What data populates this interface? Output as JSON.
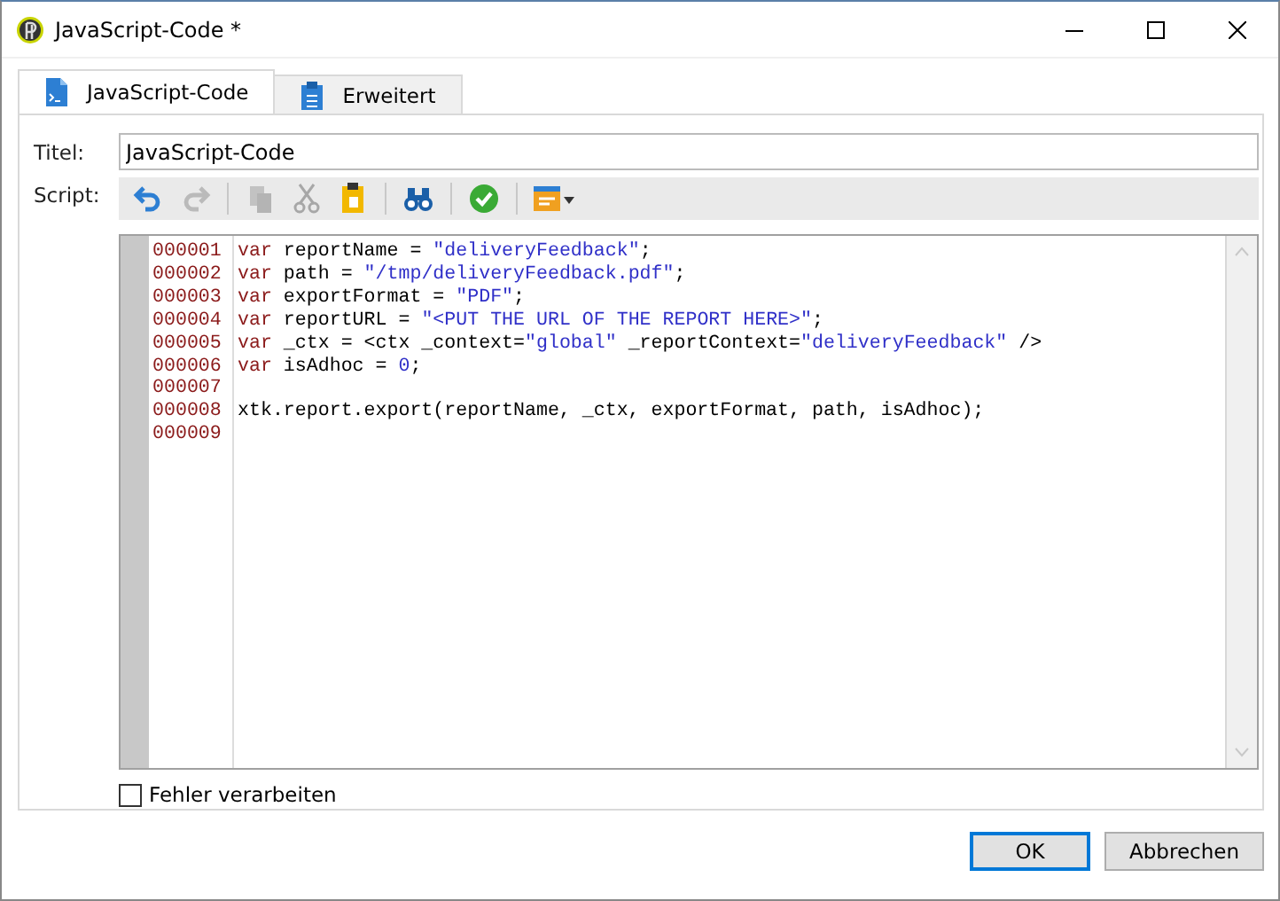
{
  "window": {
    "title": "JavaScript-Code *"
  },
  "tabs": [
    {
      "label": "JavaScript-Code",
      "selected": true,
      "kind": "script"
    },
    {
      "label": "Erweitert",
      "selected": false,
      "kind": "clipboard"
    }
  ],
  "title_field": {
    "label": "Titel:",
    "value": "JavaScript-Code"
  },
  "script": {
    "label": "Script:",
    "toolbar": [
      {
        "kind": "undo",
        "disabled": false
      },
      {
        "kind": "redo",
        "disabled": true
      },
      {
        "kind": "separator"
      },
      {
        "kind": "copy",
        "disabled": true
      },
      {
        "kind": "cut",
        "disabled": true
      },
      {
        "kind": "paste",
        "disabled": false
      },
      {
        "kind": "separator"
      },
      {
        "kind": "find",
        "disabled": false
      },
      {
        "kind": "separator"
      },
      {
        "kind": "check",
        "disabled": false
      },
      {
        "kind": "separator"
      },
      {
        "kind": "insert",
        "disabled": false
      }
    ],
    "lines": [
      {
        "number": "000001",
        "tokens": [
          {
            "kind": "keyword",
            "text": "var"
          },
          {
            "kind": "plain",
            "text": " reportName = "
          },
          {
            "kind": "string",
            "text": "\"deliveryFeedback\""
          },
          {
            "kind": "plain",
            "text": ";"
          }
        ]
      },
      {
        "number": "000002",
        "tokens": [
          {
            "kind": "keyword",
            "text": "var"
          },
          {
            "kind": "plain",
            "text": " path = "
          },
          {
            "kind": "string",
            "text": "\"/tmp/deliveryFeedback.pdf\""
          },
          {
            "kind": "plain",
            "text": ";"
          }
        ]
      },
      {
        "number": "000003",
        "tokens": [
          {
            "kind": "keyword",
            "text": "var"
          },
          {
            "kind": "plain",
            "text": " exportFormat = "
          },
          {
            "kind": "string",
            "text": "\"PDF\""
          },
          {
            "kind": "plain",
            "text": ";"
          }
        ]
      },
      {
        "number": "000004",
        "tokens": [
          {
            "kind": "keyword",
            "text": "var"
          },
          {
            "kind": "plain",
            "text": " reportURL = "
          },
          {
            "kind": "string",
            "text": "\"<PUT THE URL OF THE REPORT HERE>\""
          },
          {
            "kind": "plain",
            "text": ";"
          }
        ]
      },
      {
        "number": "000005",
        "tokens": [
          {
            "kind": "keyword",
            "text": "var"
          },
          {
            "kind": "plain",
            "text": " _ctx = <ctx _context="
          },
          {
            "kind": "string",
            "text": "\"global\""
          },
          {
            "kind": "plain",
            "text": " _reportContext="
          },
          {
            "kind": "string",
            "text": "\"deliveryFeedback\""
          },
          {
            "kind": "plain",
            "text": " />"
          }
        ]
      },
      {
        "number": "000006",
        "tokens": [
          {
            "kind": "keyword",
            "text": "var"
          },
          {
            "kind": "plain",
            "text": " isAdhoc = "
          },
          {
            "kind": "number",
            "text": "0"
          },
          {
            "kind": "plain",
            "text": ";"
          }
        ]
      },
      {
        "number": "000007"
      },
      {
        "number": "000008",
        "tokens": [
          {
            "kind": "plain",
            "text": "xtk.report.export(reportName, _ctx, exportFormat, path, isAdhoc);"
          }
        ]
      },
      {
        "number": "000009"
      }
    ]
  },
  "checkbox": {
    "label": "Fehler verarbeiten",
    "checked": false
  },
  "buttons": [
    {
      "label": "OK",
      "default": true
    },
    {
      "label": "Abbrechen",
      "default": false
    }
  ]
}
